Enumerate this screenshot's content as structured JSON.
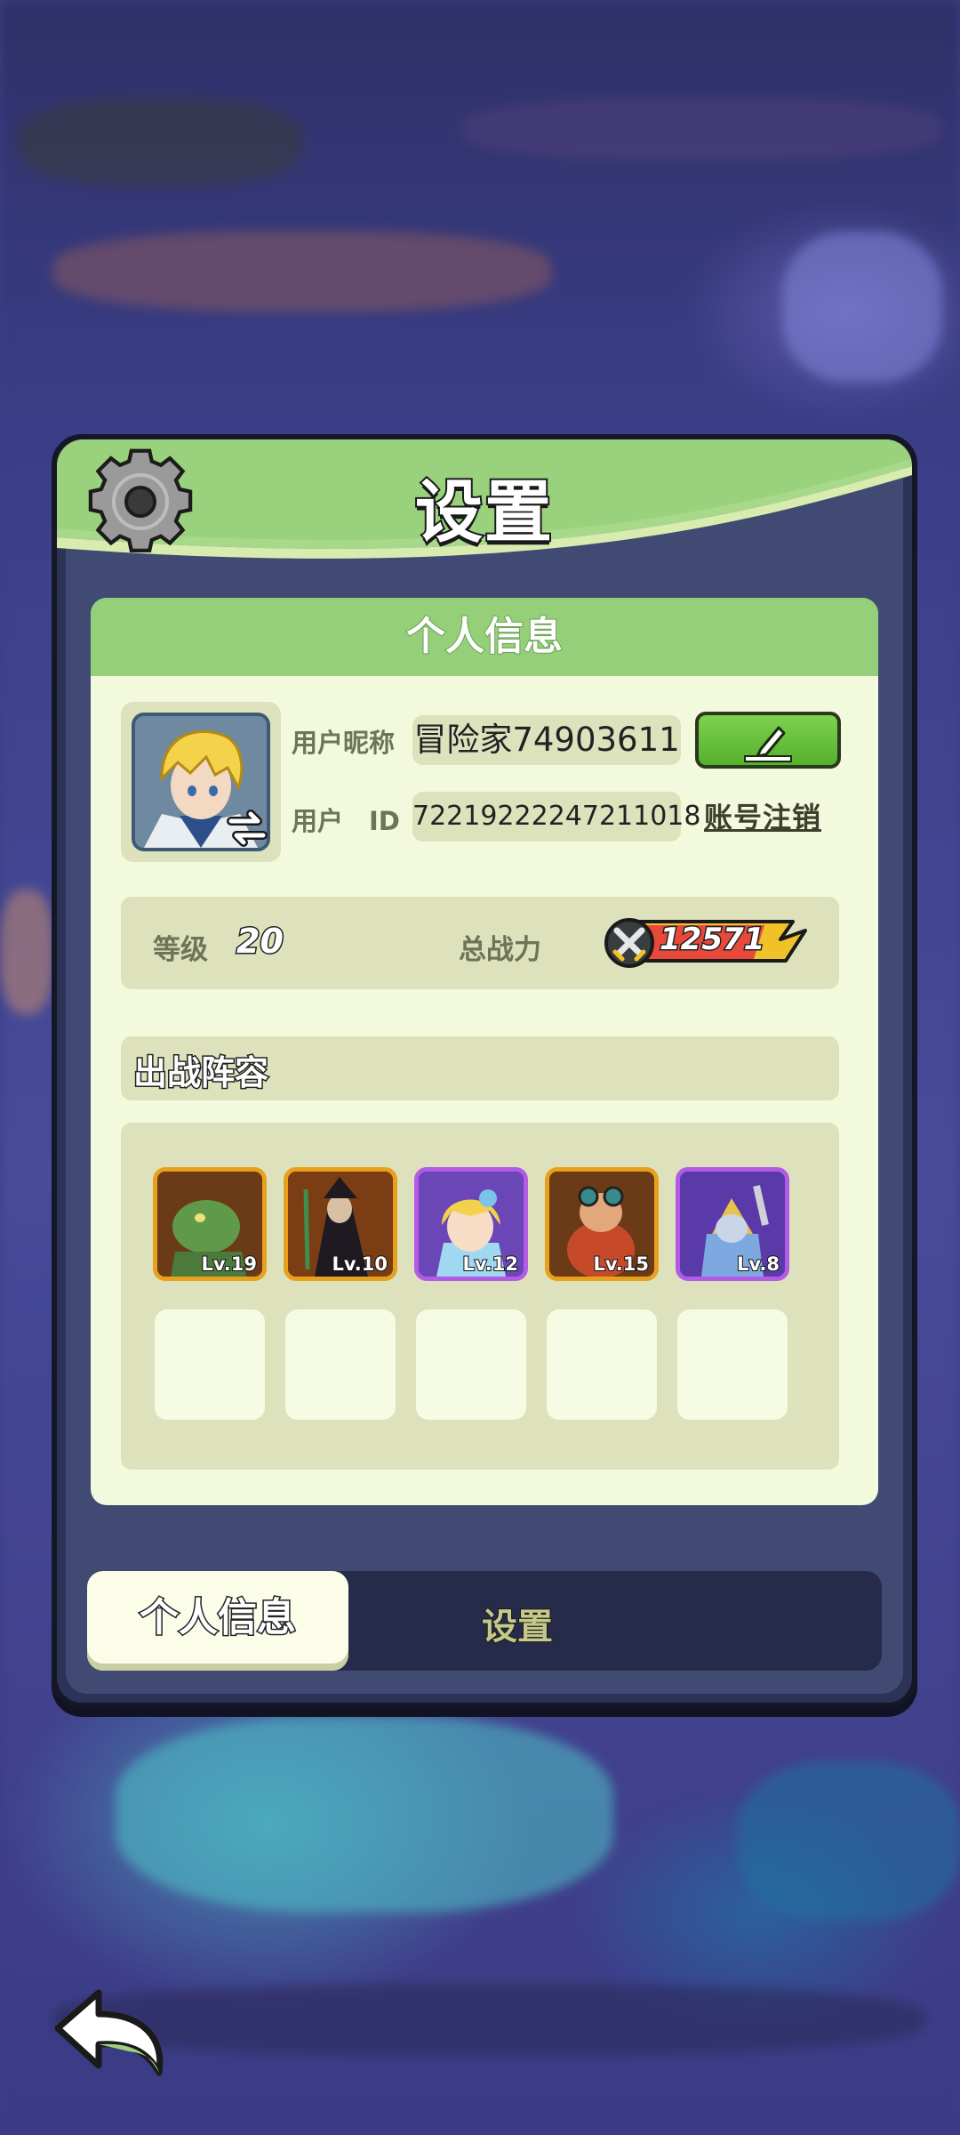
{
  "dialog": {
    "title": "设置"
  },
  "profile": {
    "section_title": "个人信息",
    "nickname_label": "用户昵称",
    "nickname_value": "冒险家74903611",
    "id_label": "用户　ID",
    "id_value": "72219222247211018",
    "cancel_account": "账号注销"
  },
  "stats": {
    "level_label": "等级",
    "level_value": "20",
    "power_label": "总战力",
    "power_value": "12571"
  },
  "team": {
    "title": "出战阵容",
    "heroes": [
      {
        "level": "Lv.19",
        "rarity": "orange",
        "icon": "lizard-hero-portrait"
      },
      {
        "level": "Lv.10",
        "rarity": "orange",
        "icon": "dark-wizard-hero-portrait"
      },
      {
        "level": "Lv.12",
        "rarity": "purple",
        "icon": "blonde-girl-hero-portrait"
      },
      {
        "level": "Lv.15",
        "rarity": "orange",
        "icon": "dwarf-hero-portrait"
      },
      {
        "level": "Lv.8",
        "rarity": "purple",
        "icon": "armored-hero-portrait"
      }
    ],
    "empty_slots": 5
  },
  "tabs": [
    {
      "label": "个人信息",
      "active": true
    },
    {
      "label": "设置",
      "active": false
    }
  ],
  "colors": {
    "header_green": "#95cf7a",
    "panel_cream": "#f3f9dc",
    "card_beige": "#dde2bd",
    "edit_green": "#55b02e",
    "orange_frame": "#e8a11d",
    "purple_frame": "#b45be6"
  },
  "icons": {
    "settings": "gear-icon",
    "edit": "pencil-icon",
    "swap_avatar": "swap-arrows-icon",
    "power": "crossed-swords-icon",
    "back": "back-arrow-icon"
  }
}
